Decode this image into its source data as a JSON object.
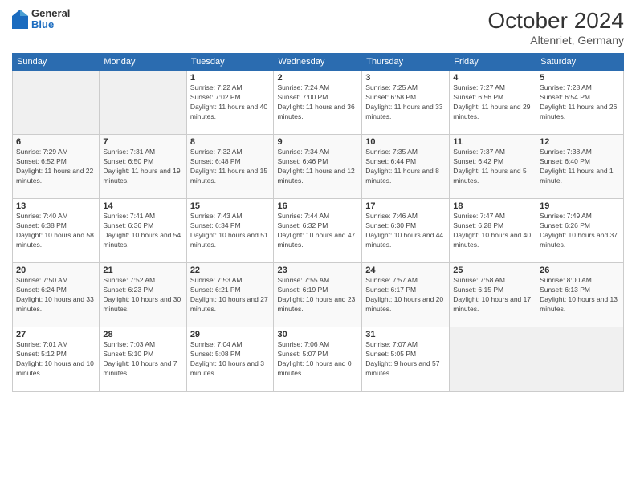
{
  "header": {
    "logo": {
      "general": "General",
      "blue": "Blue"
    },
    "month": "October 2024",
    "location": "Altenriet, Germany"
  },
  "weekdays": [
    "Sunday",
    "Monday",
    "Tuesday",
    "Wednesday",
    "Thursday",
    "Friday",
    "Saturday"
  ],
  "weeks": [
    [
      {
        "day": "",
        "info": ""
      },
      {
        "day": "",
        "info": ""
      },
      {
        "day": "1",
        "info": "Sunrise: 7:22 AM\nSunset: 7:02 PM\nDaylight: 11 hours and 40 minutes."
      },
      {
        "day": "2",
        "info": "Sunrise: 7:24 AM\nSunset: 7:00 PM\nDaylight: 11 hours and 36 minutes."
      },
      {
        "day": "3",
        "info": "Sunrise: 7:25 AM\nSunset: 6:58 PM\nDaylight: 11 hours and 33 minutes."
      },
      {
        "day": "4",
        "info": "Sunrise: 7:27 AM\nSunset: 6:56 PM\nDaylight: 11 hours and 29 minutes."
      },
      {
        "day": "5",
        "info": "Sunrise: 7:28 AM\nSunset: 6:54 PM\nDaylight: 11 hours and 26 minutes."
      }
    ],
    [
      {
        "day": "6",
        "info": "Sunrise: 7:29 AM\nSunset: 6:52 PM\nDaylight: 11 hours and 22 minutes."
      },
      {
        "day": "7",
        "info": "Sunrise: 7:31 AM\nSunset: 6:50 PM\nDaylight: 11 hours and 19 minutes."
      },
      {
        "day": "8",
        "info": "Sunrise: 7:32 AM\nSunset: 6:48 PM\nDaylight: 11 hours and 15 minutes."
      },
      {
        "day": "9",
        "info": "Sunrise: 7:34 AM\nSunset: 6:46 PM\nDaylight: 11 hours and 12 minutes."
      },
      {
        "day": "10",
        "info": "Sunrise: 7:35 AM\nSunset: 6:44 PM\nDaylight: 11 hours and 8 minutes."
      },
      {
        "day": "11",
        "info": "Sunrise: 7:37 AM\nSunset: 6:42 PM\nDaylight: 11 hours and 5 minutes."
      },
      {
        "day": "12",
        "info": "Sunrise: 7:38 AM\nSunset: 6:40 PM\nDaylight: 11 hours and 1 minute."
      }
    ],
    [
      {
        "day": "13",
        "info": "Sunrise: 7:40 AM\nSunset: 6:38 PM\nDaylight: 10 hours and 58 minutes."
      },
      {
        "day": "14",
        "info": "Sunrise: 7:41 AM\nSunset: 6:36 PM\nDaylight: 10 hours and 54 minutes."
      },
      {
        "day": "15",
        "info": "Sunrise: 7:43 AM\nSunset: 6:34 PM\nDaylight: 10 hours and 51 minutes."
      },
      {
        "day": "16",
        "info": "Sunrise: 7:44 AM\nSunset: 6:32 PM\nDaylight: 10 hours and 47 minutes."
      },
      {
        "day": "17",
        "info": "Sunrise: 7:46 AM\nSunset: 6:30 PM\nDaylight: 10 hours and 44 minutes."
      },
      {
        "day": "18",
        "info": "Sunrise: 7:47 AM\nSunset: 6:28 PM\nDaylight: 10 hours and 40 minutes."
      },
      {
        "day": "19",
        "info": "Sunrise: 7:49 AM\nSunset: 6:26 PM\nDaylight: 10 hours and 37 minutes."
      }
    ],
    [
      {
        "day": "20",
        "info": "Sunrise: 7:50 AM\nSunset: 6:24 PM\nDaylight: 10 hours and 33 minutes."
      },
      {
        "day": "21",
        "info": "Sunrise: 7:52 AM\nSunset: 6:23 PM\nDaylight: 10 hours and 30 minutes."
      },
      {
        "day": "22",
        "info": "Sunrise: 7:53 AM\nSunset: 6:21 PM\nDaylight: 10 hours and 27 minutes."
      },
      {
        "day": "23",
        "info": "Sunrise: 7:55 AM\nSunset: 6:19 PM\nDaylight: 10 hours and 23 minutes."
      },
      {
        "day": "24",
        "info": "Sunrise: 7:57 AM\nSunset: 6:17 PM\nDaylight: 10 hours and 20 minutes."
      },
      {
        "day": "25",
        "info": "Sunrise: 7:58 AM\nSunset: 6:15 PM\nDaylight: 10 hours and 17 minutes."
      },
      {
        "day": "26",
        "info": "Sunrise: 8:00 AM\nSunset: 6:13 PM\nDaylight: 10 hours and 13 minutes."
      }
    ],
    [
      {
        "day": "27",
        "info": "Sunrise: 7:01 AM\nSunset: 5:12 PM\nDaylight: 10 hours and 10 minutes."
      },
      {
        "day": "28",
        "info": "Sunrise: 7:03 AM\nSunset: 5:10 PM\nDaylight: 10 hours and 7 minutes."
      },
      {
        "day": "29",
        "info": "Sunrise: 7:04 AM\nSunset: 5:08 PM\nDaylight: 10 hours and 3 minutes."
      },
      {
        "day": "30",
        "info": "Sunrise: 7:06 AM\nSunset: 5:07 PM\nDaylight: 10 hours and 0 minutes."
      },
      {
        "day": "31",
        "info": "Sunrise: 7:07 AM\nSunset: 5:05 PM\nDaylight: 9 hours and 57 minutes."
      },
      {
        "day": "",
        "info": ""
      },
      {
        "day": "",
        "info": ""
      }
    ]
  ]
}
